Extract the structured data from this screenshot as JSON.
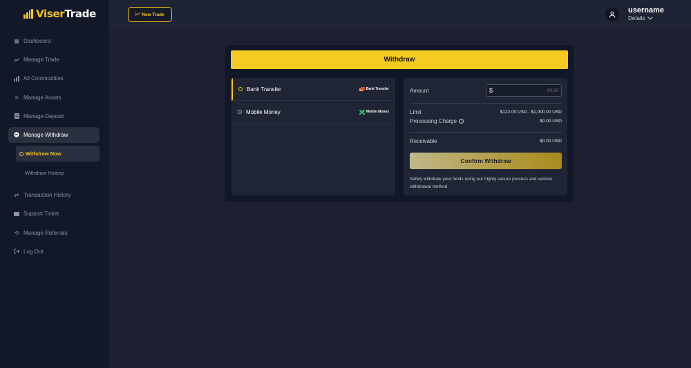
{
  "brand": {
    "name_part1": "Viser",
    "name_part2": "Trade",
    "accent": "#f5c518"
  },
  "sidebar": {
    "items": [
      {
        "label": "Dashboard",
        "icon": "grid-icon"
      },
      {
        "label": "Manage Trade",
        "icon": "chart-line-icon"
      },
      {
        "label": "All Commodities",
        "icon": "bar-chart-icon"
      },
      {
        "label": "Manage Assets",
        "icon": "stack-icon"
      },
      {
        "label": "Manage Deposit",
        "icon": "document-icon"
      },
      {
        "label": "Manage Withdraw",
        "icon": "wallet-icon",
        "active": true
      }
    ],
    "withdraw_sub": [
      {
        "label": "Withdraw Now",
        "current": true
      },
      {
        "label": "Withdraw History"
      }
    ],
    "items_after": [
      {
        "label": "Transaction History",
        "icon": "arrows-swap-icon"
      },
      {
        "label": "Support Ticket",
        "icon": "ticket-icon"
      },
      {
        "label": "Manage Referrals",
        "icon": "refresh-icon"
      },
      {
        "label": "Log Out",
        "icon": "logout-icon"
      }
    ]
  },
  "topbar": {
    "new_trade_label": "New Trade",
    "username": "username",
    "details_label": "Details"
  },
  "withdraw": {
    "title": "Withdraw",
    "methods": [
      {
        "label": "Bank Transfer",
        "logo_text": "Bank Transfer",
        "selected": true
      },
      {
        "label": "Mobile Money",
        "logo_text": "Mobile Money",
        "selected": false
      }
    ],
    "amount_label": "Amount",
    "currency_symbol": "$",
    "amount_placeholder": "00.00",
    "limit_label": "Limit",
    "limit_value": "$122.00 USD - $1,000.00 USD",
    "charge_label": "Processing Charge",
    "charge_value": "$0.00 USD",
    "receivable_label": "Receivable",
    "receivable_value": "$0.00 USD",
    "confirm_label": "Confirm Withdraw",
    "note": "Safely withdraw your funds using our highly secure process and various withdrawal method"
  }
}
